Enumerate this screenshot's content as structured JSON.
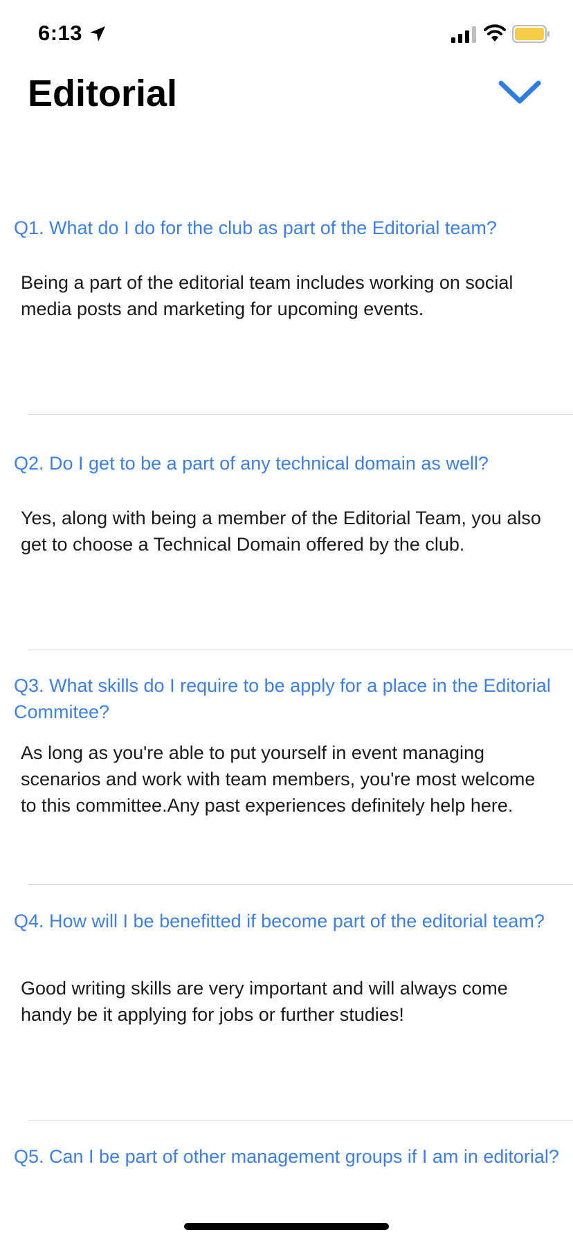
{
  "status_bar": {
    "time": "6:13",
    "battery_color": "#f5cc45"
  },
  "header": {
    "title": "Editorial",
    "collapse_icon": "chevron-down-icon"
  },
  "colors": {
    "question": "#3d7fe6",
    "answer": "#1a1a1a",
    "divider": "#d6d6d6"
  },
  "faqs": [
    {
      "question": "Q1. What do I do for the club as part of the Editorial team?",
      "answer": "Being a part of the editorial team includes working on social media posts and marketing for upcoming events."
    },
    {
      "question": "Q2. Do I get to be a part of any technical domain as well?",
      "answer": "Yes, along with being a member of the Editorial Team, you also get to choose a Technical Domain offered by the club."
    },
    {
      "question": "Q3. What skills do I require to be apply for a place in the Editorial Commitee?",
      "answer": "As long as you're able to put yourself in event managing scenarios and work with team members, you're most welcome to this committee.Any past experiences definitely help here."
    },
    {
      "question": "Q4. How will I be benefitted if become part of the editorial team?",
      "answer": "Good writing skills are very important and will always come handy be it applying for jobs or further studies!"
    },
    {
      "question": "Q5. Can I be part of other management groups if I am in editorial?",
      "answer": ""
    }
  ]
}
